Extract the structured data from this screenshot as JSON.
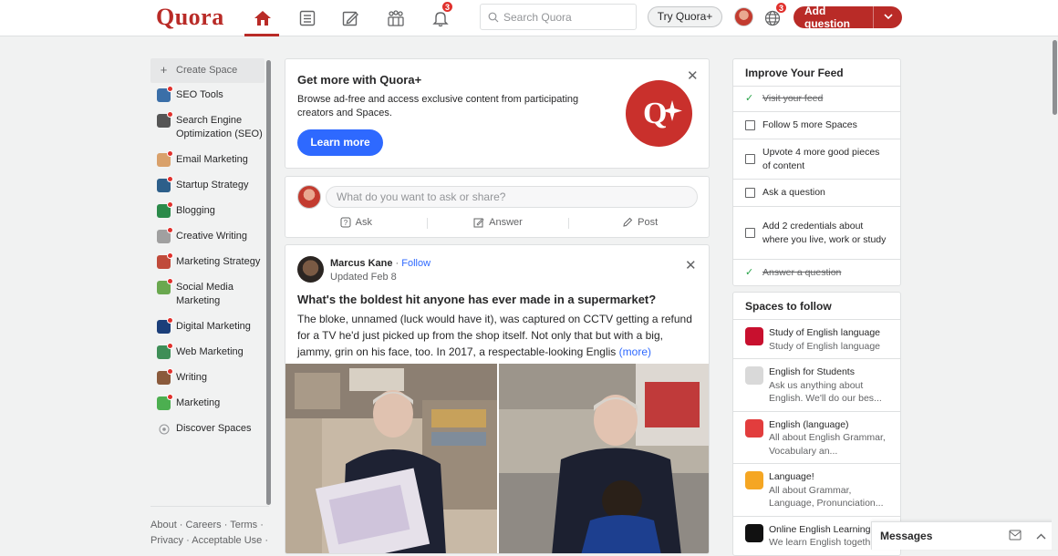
{
  "brand": {
    "logo_text": "Quora",
    "accent_color": "#b92b27",
    "link_color": "#2e69ff"
  },
  "header": {
    "notifications_badge": "3",
    "globe_badge": "3",
    "search_placeholder": "Search Quora",
    "try_plus_label": "Try Quora+",
    "add_question_label": "Add question",
    "nav_icons": [
      "home-icon",
      "following-icon",
      "answer-icon",
      "spaces-icon",
      "notifications-icon"
    ]
  },
  "sidebar": {
    "create_space": "Create Space",
    "items": [
      {
        "label": "SEO Tools",
        "color": "#3b6fa8"
      },
      {
        "label": "Search Engine Optimization (SEO)",
        "color": "#555555"
      },
      {
        "label": "Email Marketing",
        "color": "#d9a16b"
      },
      {
        "label": "Startup Strategy",
        "color": "#2d5f8a"
      },
      {
        "label": "Blogging",
        "color": "#2b8a4a"
      },
      {
        "label": "Creative Writing",
        "color": "#a0a0a0"
      },
      {
        "label": "Marketing Strategy",
        "color": "#c04a3a"
      },
      {
        "label": "Social Media Marketing",
        "color": "#6aa84f"
      },
      {
        "label": "Digital Marketing",
        "color": "#1c3f7a"
      },
      {
        "label": "Web Marketing",
        "color": "#3e8e57"
      },
      {
        "label": "Writing",
        "color": "#8a5a3c"
      },
      {
        "label": "Marketing",
        "color": "#4caf50"
      }
    ],
    "discover": "Discover Spaces",
    "footer_line1": "About · Careers · Terms ·",
    "footer_line2": "Privacy · Acceptable Use ·"
  },
  "promo": {
    "title": "Get more with Quora+",
    "text": "Browse ad-free and access exclusive content from participating creators and Spaces.",
    "button": "Learn more",
    "badge_text": "Q+"
  },
  "ask": {
    "placeholder": "What do you want to ask or share?",
    "ask_label": "Ask",
    "answer_label": "Answer",
    "post_label": "Post"
  },
  "post": {
    "author": "Marcus Kane",
    "follow_label": "Follow",
    "updated": "Updated Feb 8",
    "title": "What's the boldest hit anyone has ever made in a supermarket?",
    "body": "The bloke, unnamed (luck would have it), was captured on CCTV getting a refund for a TV he'd just picked up from the shop itself. Not only that but with a big, jammy, grin on his face, too. In 2017, a respectable-looking Englis",
    "more_label": "(more)"
  },
  "improve_feed": {
    "title": "Improve Your Feed",
    "items": [
      {
        "label": "Visit your feed",
        "done": true
      },
      {
        "label": "Follow 5 more Spaces",
        "done": false
      },
      {
        "label": "Upvote 4 more good pieces of content",
        "done": false
      },
      {
        "label": "Ask a question",
        "done": false
      },
      {
        "label": "Add 2 credentials about where you live, work or study",
        "done": false
      },
      {
        "label": "Answer a question",
        "done": true
      }
    ]
  },
  "spaces_to_follow": {
    "title": "Spaces to follow",
    "items": [
      {
        "name": "Study of English language",
        "desc": "Study of English language",
        "color": "#c8102e"
      },
      {
        "name": "English for Students",
        "desc": "Ask us anything about English. We'll do our bes...",
        "color": "#d9d9d9"
      },
      {
        "name": "English (language)",
        "desc": "All about English Grammar, Vocabulary an...",
        "color": "#e23d3d"
      },
      {
        "name": "Language!",
        "desc": "All about Grammar, Language, Pronunciation...",
        "color": "#f5a623"
      },
      {
        "name": "Online English Learning",
        "desc": "We learn English togeth",
        "color": "#111111"
      }
    ]
  },
  "messages": {
    "title": "Messages"
  }
}
